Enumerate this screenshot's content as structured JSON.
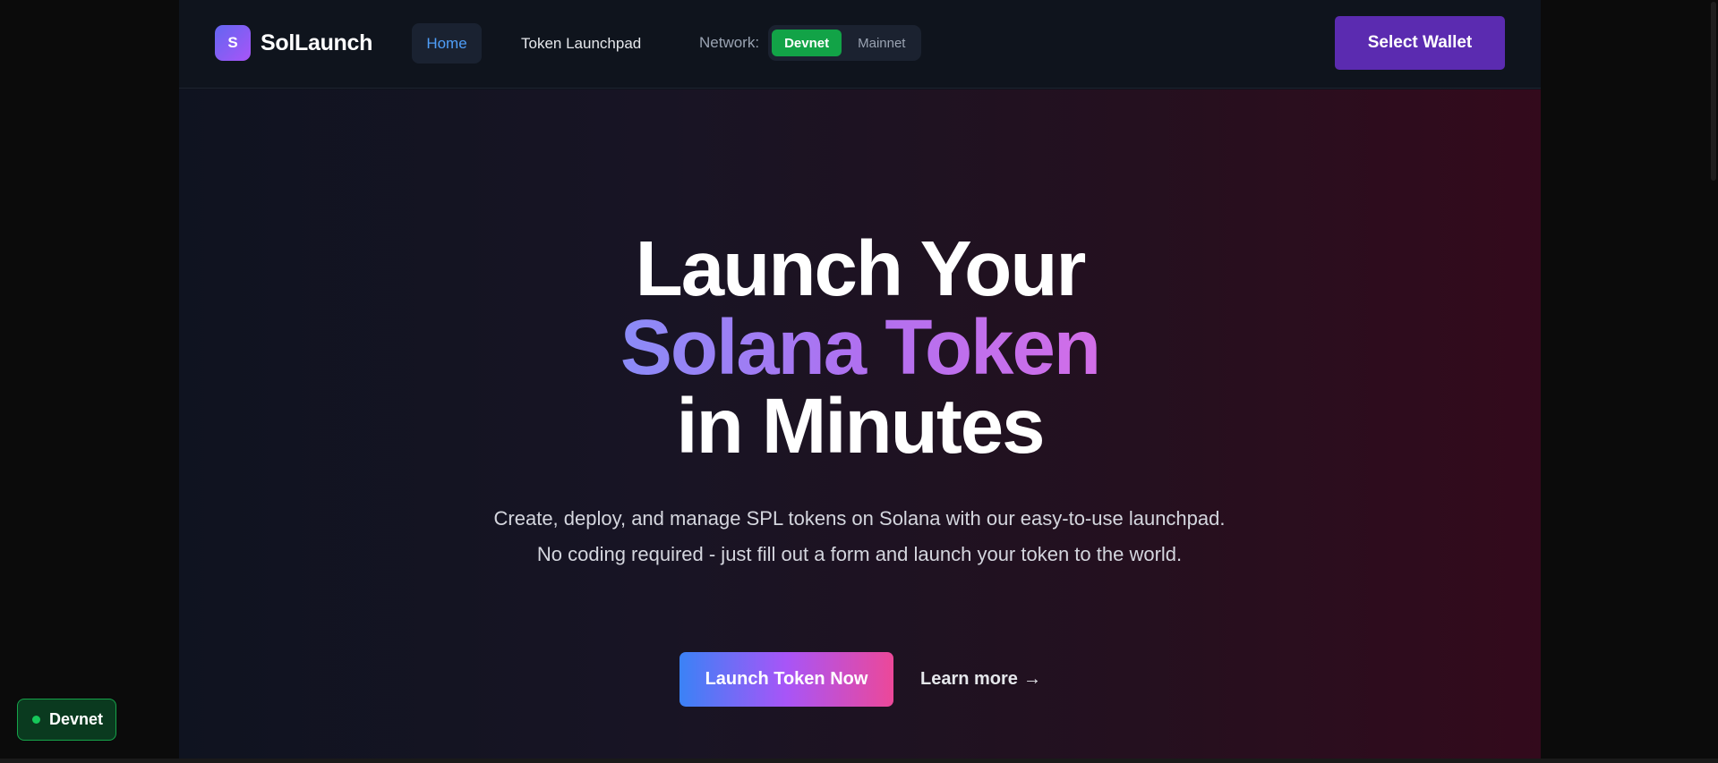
{
  "brand": {
    "logo_letter": "S",
    "name": "SolLaunch"
  },
  "nav": {
    "items": [
      {
        "label": "Home",
        "active": true
      },
      {
        "label": "Token Launchpad",
        "active": false
      }
    ],
    "network": {
      "label": "Network:",
      "options": [
        {
          "label": "Devnet",
          "selected": true
        },
        {
          "label": "Mainnet",
          "selected": false
        }
      ]
    },
    "wallet_button": "Select Wallet"
  },
  "hero": {
    "title_line1": "Launch Your",
    "title_line2": "Solana Token",
    "title_line3": "in Minutes",
    "subtitle": "Create, deploy, and manage SPL tokens on Solana with our easy-to-use launchpad. No coding required - just fill out a form and launch your token to the world.",
    "primary_cta": "Launch Token Now",
    "secondary_cta": "Learn more",
    "secondary_cta_arrow": "→"
  },
  "status_badge": {
    "label": "Devnet"
  },
  "colors": {
    "accent_purple": "#5b2bb0",
    "network_active": "#12a347",
    "nav_active_text": "#4f9ef8"
  },
  "icons": {
    "brand": "sollaunch-logo-icon",
    "arrow": "arrow-right-icon",
    "status": "status-dot-icon"
  }
}
